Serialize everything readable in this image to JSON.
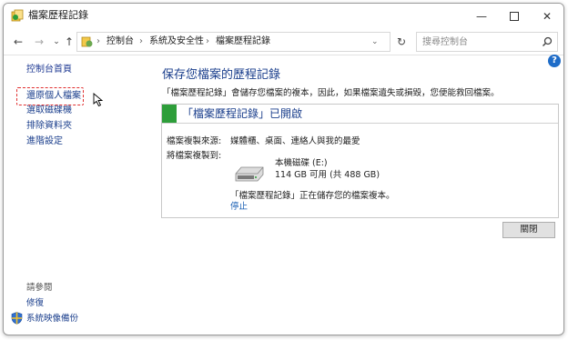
{
  "window": {
    "title": "檔案歷程記錄",
    "controls": {
      "minimize_icon": "minimize-icon",
      "maximize_icon": "maximize-icon",
      "close_icon": "close-icon"
    }
  },
  "address": {
    "breadcrumbs": [
      "控制台",
      "系統及安全性",
      "檔案歷程記錄"
    ],
    "search_placeholder": "搜尋控制台"
  },
  "sidebar": {
    "home": "控制台首頁",
    "links": [
      "還原個人檔案",
      "選取磁碟機",
      "排除資料夾",
      "進階設定"
    ],
    "see_also_title": "請參閱",
    "see_also_links": [
      "修復",
      "系統映像備份"
    ]
  },
  "main": {
    "heading": "保存您檔案的歷程記錄",
    "description": "「檔案歷程記錄」會儲存您檔案的複本，因此，如果檔案遺失或損毀，您便能救回檔案。",
    "status_title": "「檔案歷程記錄」已開啟",
    "copy_from_label": "檔案複製來源:",
    "copy_from_value": "媒體櫃、桌面、連絡人與我的最愛",
    "copy_to_label": "將檔案複製到:",
    "drive_name": "本機磁碟 (E:)",
    "drive_space": "114 GB 可用 (共 488 GB)",
    "saving_status": "「檔案歷程記錄」正在儲存您的檔案複本。",
    "stop_link": "停止",
    "close_button": "關閉"
  },
  "colors": {
    "accent_green": "#2e9e3a",
    "link_blue": "#1a5fb4",
    "highlight_red": "#e03030"
  }
}
